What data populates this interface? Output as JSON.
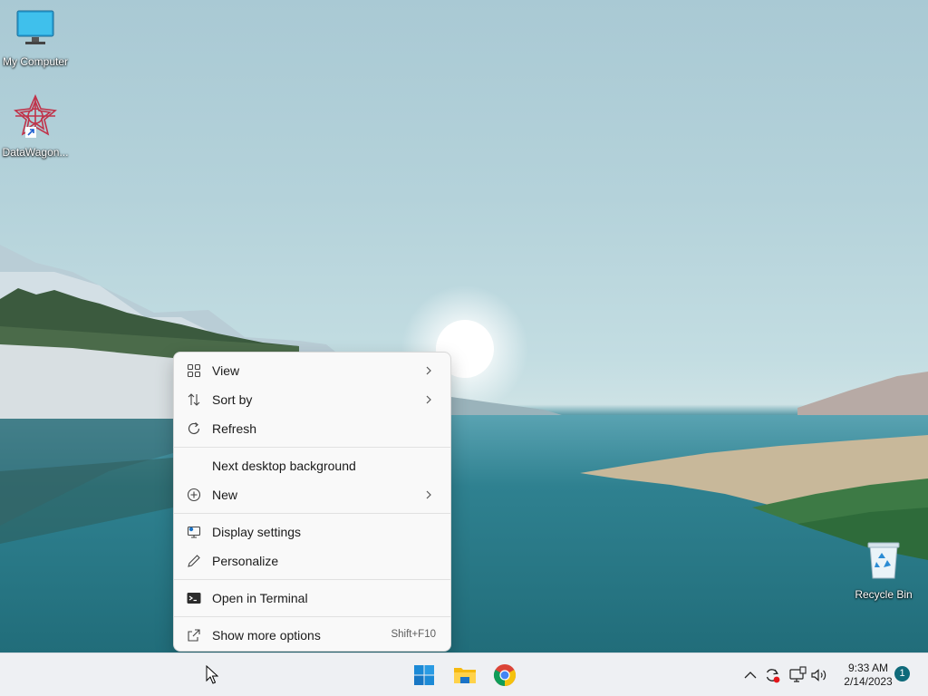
{
  "desktop": {
    "icons": [
      {
        "label": "My Computer",
        "icon": "monitor-icon"
      },
      {
        "label": "DataWagon...",
        "icon": "datawagon-app-icon"
      },
      {
        "label": "Recycle Bin",
        "icon": "recycle-bin-icon"
      }
    ]
  },
  "context_menu": {
    "items": [
      {
        "label": "View",
        "icon": "view-grid-icon",
        "submenu": true
      },
      {
        "label": "Sort by",
        "icon": "sort-arrows-icon",
        "submenu": true
      },
      {
        "label": "Refresh",
        "icon": "refresh-icon",
        "submenu": false
      },
      {
        "label": "Next desktop background",
        "icon": "",
        "submenu": false
      },
      {
        "label": "New",
        "icon": "plus-circle-icon",
        "submenu": true
      },
      {
        "label": "Display settings",
        "icon": "display-settings-icon",
        "submenu": false
      },
      {
        "label": "Personalize",
        "icon": "pen-icon",
        "submenu": false
      },
      {
        "label": "Open in Terminal",
        "icon": "terminal-icon",
        "submenu": false
      },
      {
        "label": "Show more options",
        "icon": "share-open-icon",
        "shortcut": "Shift+F10"
      }
    ]
  },
  "taskbar": {
    "apps": [
      {
        "name": "Start",
        "icon": "windows-start-icon"
      },
      {
        "name": "File Explorer",
        "icon": "folder-icon"
      },
      {
        "name": "Google Chrome",
        "icon": "chrome-icon"
      }
    ],
    "tray": {
      "icons": [
        "chevron-up-icon",
        "sync-icon",
        "network-icon",
        "volume-icon"
      ],
      "time": "9:33 AM",
      "date": "2/14/2023",
      "notification_count": "1"
    }
  },
  "colors": {
    "accent": "#0f6a7a",
    "menu_bg": "#f9f9f9",
    "taskbar_bg": "#eef0f3"
  }
}
